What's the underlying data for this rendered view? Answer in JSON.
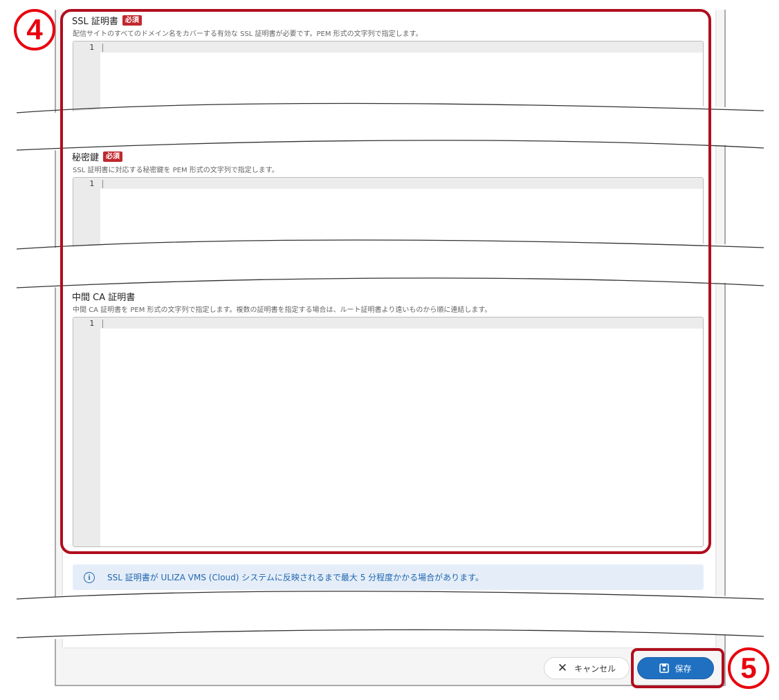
{
  "markers": {
    "four": "④",
    "five": "⑤"
  },
  "fields": [
    {
      "label": "SSL 証明書",
      "required": "必須",
      "description": "配信サイトのすべてのドメイン名をカバーする有効な SSL 証明書が必要です。PEM 形式の文字列で指定します。",
      "line_number": "1"
    },
    {
      "label": "秘密鍵",
      "required": "必須",
      "description": "SSL 証明書に対応する秘密鍵を PEM 形式の文字列で指定します。",
      "line_number": "1"
    },
    {
      "label": "中間 CA 証明書",
      "description": "中間 CA 証明書を PEM 形式の文字列で指定します。複数の証明書を指定する場合は、ルート証明書より遠いものから順に連結します。",
      "line_number": "1"
    }
  ],
  "info": {
    "icon": "info-icon",
    "message": "SSL 証明書が ULIZA VMS (Cloud) システムに反映されるまで最大 5 分程度かかる場合があります。"
  },
  "actions": {
    "cancel_label": "キャンセル",
    "save_label": "保存",
    "cancel_icon": "close-icon",
    "save_icon": "save-icon"
  },
  "colors": {
    "highlight": "#b00e1e",
    "marker": "#e8000d",
    "badge": "#c0282e",
    "primary": "#1f70c1",
    "info_bg": "#e5eef8",
    "info_text": "#2166b0"
  }
}
